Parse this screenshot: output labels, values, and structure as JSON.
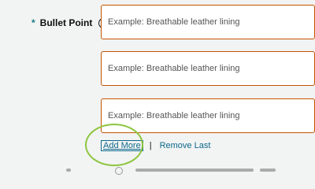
{
  "field": {
    "required_marker": "*",
    "label": "Bullet Point",
    "info_glyph": "?"
  },
  "bullet_points": [
    {
      "placeholder": "Example: Breathable leather lining",
      "value": ""
    },
    {
      "placeholder": "Example: Breathable leather lining",
      "value": ""
    },
    {
      "placeholder": "Example: Breathable leather lining",
      "value": ""
    }
  ],
  "actions": {
    "add_more": "Add More",
    "separator": "|",
    "remove_last": "Remove Last"
  },
  "colors": {
    "background": "#f2f3f3",
    "input_border": "#c45500",
    "link": "#0c6a8c",
    "required": "#0f7f85",
    "highlight_ring": "#8dc63f"
  }
}
